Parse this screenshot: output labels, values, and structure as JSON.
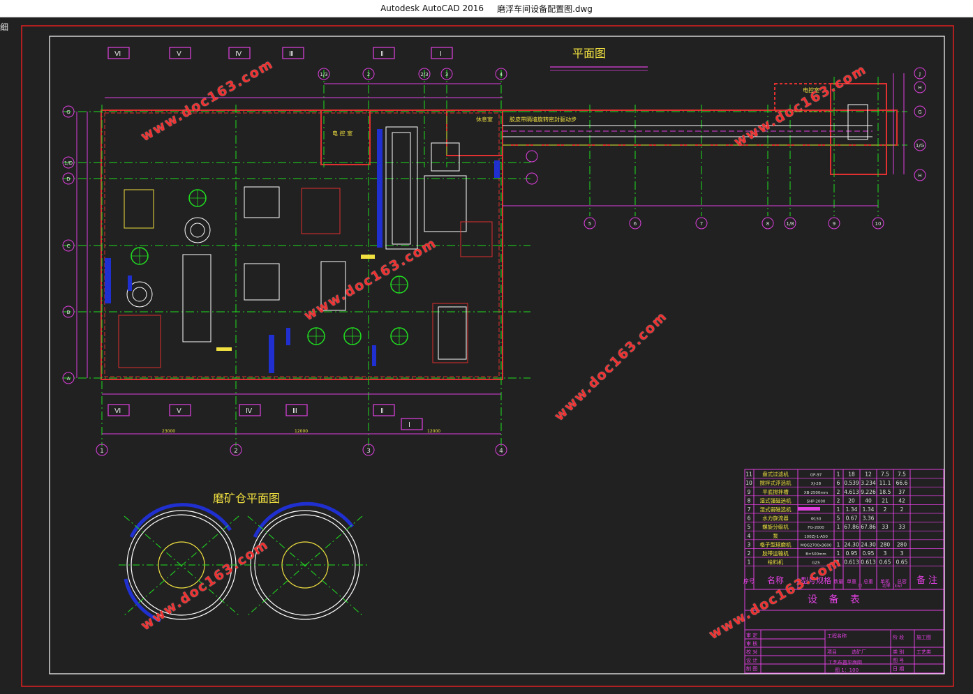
{
  "window": {
    "app_name": "Autodesk AutoCAD 2016",
    "file_name": "磨浮车间设备配置图.dwg",
    "corner_tag": "细"
  },
  "drawing": {
    "plan_title": "平面图",
    "bin_title": "磨矿仓平面图",
    "rooms": {
      "control_room_1": "电 控 室",
      "control_room_2": "电控室",
      "rest_room": "休息室",
      "conveyor_note": "胶皮带隔墙旋转密封驱动步"
    },
    "section_marks_top": [
      "Ⅵ",
      "Ⅴ",
      "Ⅳ",
      "Ⅲ",
      "Ⅱ",
      "Ⅰ"
    ],
    "section_marks_bottom": [
      "Ⅵ",
      "Ⅴ",
      "Ⅳ",
      "Ⅲ",
      "Ⅱ",
      "Ⅰ"
    ],
    "axis_bubbles_bottom": [
      "1",
      "2",
      "3",
      "4"
    ],
    "axis_bubbles_top": [
      "1/3",
      "2",
      "2/3",
      "3",
      "4"
    ],
    "axis_bubbles_right": [
      "5",
      "6",
      "7",
      "8",
      "1/8",
      "9",
      "10"
    ],
    "axis_bubbles_left": [
      "G",
      "1/D",
      "D",
      "C",
      "B",
      "A"
    ],
    "axis_bubbles_far_right": [
      "J",
      "H",
      "G",
      "1/G",
      "H"
    ],
    "dims_bottom": [
      "23000",
      "12000",
      "12000"
    ]
  },
  "equipment_table": {
    "title": "设 备 表",
    "rows": [
      {
        "no": "11",
        "name": "盘式过滤机",
        "model": "GP-97",
        "qty": "1",
        "unit": "18",
        "total": "12",
        "power": "7.5",
        "total_power": "7.5"
      },
      {
        "no": "10",
        "name": "搅拌式浮选机",
        "model": "XJ-28",
        "qty": "6",
        "unit": "0.539",
        "total": "3.234",
        "power": "11.1",
        "total_power": "66.6"
      },
      {
        "no": "9",
        "name": "平底搅拌槽",
        "model": "XB-2500mm",
        "qty": "2",
        "unit": "4.613",
        "total": "9.226",
        "power": "18.5",
        "total_power": "37"
      },
      {
        "no": "8",
        "name": "湿式强磁选机",
        "model": "SHP-2000",
        "qty": "2",
        "unit": "20",
        "total": "40",
        "power": "21",
        "total_power": "42"
      },
      {
        "no": "7",
        "name": "湿式弱磁选机",
        "model": "",
        "qty": "1",
        "unit": "1.34",
        "total": "1.34",
        "power": "2",
        "total_power": "2"
      },
      {
        "no": "6",
        "name": "水力旋流器",
        "model": "Φ150",
        "qty": "5",
        "unit": "0.67",
        "total": "3.36",
        "power": "",
        "total_power": ""
      },
      {
        "no": "5",
        "name": "螺旋分级机",
        "model": "FG-2000",
        "qty": "1",
        "unit": "67.86",
        "total": "67.86",
        "power": "33",
        "total_power": "33"
      },
      {
        "no": "4",
        "name": "泵",
        "model": "100ZJ-1-A50",
        "qty": "",
        "unit": "",
        "total": "",
        "power": "",
        "total_power": ""
      },
      {
        "no": "3",
        "name": "格子型球磨机",
        "model": "MQG2700x3600",
        "qty": "1",
        "unit": "24.30",
        "total": "24.30",
        "power": "280",
        "total_power": "280"
      },
      {
        "no": "2",
        "name": "胶带运输机",
        "model": "B=500mm",
        "qty": "1",
        "unit": "0.95",
        "total": "0.95",
        "power": "3",
        "total_power": "3"
      },
      {
        "no": "1",
        "name": "给料机",
        "model": "GZ5",
        "qty": "1",
        "unit": "0.613",
        "total": "0.613",
        "power": "0.65",
        "total_power": "0.65"
      }
    ],
    "header": {
      "no": "序号",
      "name": "名称",
      "model": "型号规格",
      "qty": "数量",
      "unit_weight": "单重",
      "total_weight": "总重",
      "weight_unit": "（t）",
      "unit_power": "单机",
      "total_power": "总容",
      "power_unit": "功率（kw）",
      "remark": "备 注"
    }
  },
  "title_block": {
    "left_labels": [
      "审 定",
      "审 核",
      "校 对",
      "设 计",
      "制 图"
    ],
    "project_label": "工程名称",
    "item_label": "项目",
    "factory": "选矿厂",
    "drawing_name": "工艺布置平面图",
    "scale": "图 1：100",
    "stage_label": "阶 段",
    "stage_value": "施工图",
    "category_label": "类 别",
    "category_value": "工艺类",
    "number_label": "图 号",
    "date_label": "日 期"
  },
  "watermarks": [
    "www.doc163.com",
    "www.doc163.com",
    "www.doc163.com",
    "www.doc163.com",
    "www.doc163.com",
    "www.doc163.com",
    "www.doc163.com"
  ],
  "colors": {
    "background": "#212121",
    "frame_red": "#e02020",
    "axis_magenta": "#e040e0",
    "wall_red": "#e03030",
    "center_green": "#20e020",
    "text_yellow": "#f0e040",
    "equipment_white": "#ffffff",
    "blue": "#2030d0"
  }
}
